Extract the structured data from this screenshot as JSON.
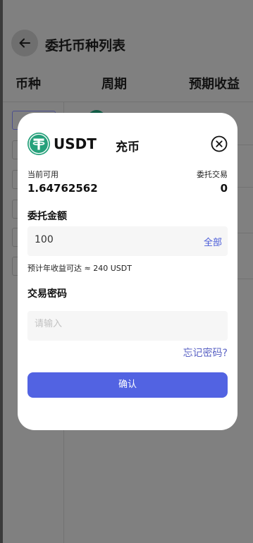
{
  "header": {
    "title": "委托币种列表"
  },
  "columns": [
    "币种",
    "周期",
    "预期收益"
  ],
  "modal": {
    "coin": "USDT",
    "title": "充币",
    "available_label": "当前可用",
    "available_value": "1.64762562",
    "delegate_label": "委托交易",
    "delegate_value": "0",
    "amount_label": "委托金额",
    "amount_value": "100",
    "all_label": "全部",
    "hint": "预计年收益可达 ≈ 240 USDT",
    "password_label": "交易密码",
    "password_placeholder": "请输入",
    "forgot_label": "忘记密码?",
    "confirm_label": "确认"
  },
  "colors": {
    "accent": "#5263e2",
    "usdt": "#26a17b",
    "overlay": "#808080"
  }
}
